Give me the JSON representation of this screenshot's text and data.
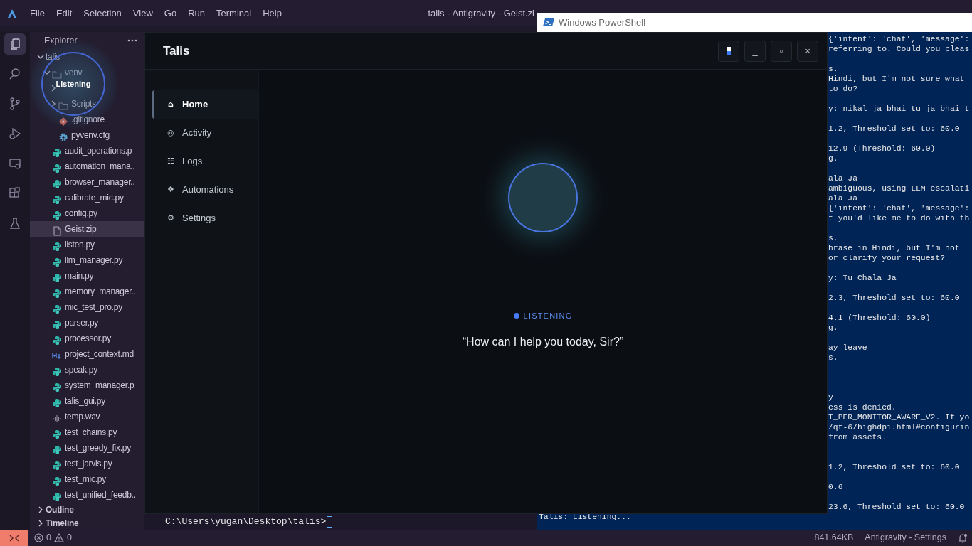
{
  "editor": {
    "menu": [
      "File",
      "Edit",
      "Selection",
      "View",
      "Go",
      "Run",
      "Terminal",
      "Help"
    ],
    "title": "talis - Antigravity - Geist.zi",
    "activity_bar": [
      {
        "kind": "files",
        "selected": true
      },
      {
        "kind": "search",
        "selected": false
      },
      {
        "kind": "branch",
        "selected": false
      },
      {
        "kind": "debug",
        "selected": false
      },
      {
        "kind": "remote",
        "selected": false
      },
      {
        "kind": "extensions",
        "selected": false
      },
      {
        "kind": "flask",
        "selected": false
      }
    ]
  },
  "explorer": {
    "title": "Explorer",
    "tree": [
      {
        "label": "talis",
        "expanded": true,
        "selected": false,
        "children": [
          {
            "label": "venv",
            "kind": "folder",
            "expanded": true,
            "selected": false,
            "children": [
              {
                "kind": "folder",
                "expanded": false
              },
              {
                "label": "Scripts",
                "kind": "folder",
                "expanded": false,
                "selected": false
              },
              {
                "label": ".gitignore",
                "kind": "git",
                "selected": false
              },
              {
                "label": "pyvenv.cfg",
                "kind": "config",
                "selected": false
              }
            ]
          },
          {
            "label": "audit_operations.p",
            "kind": "python",
            "selected": false
          },
          {
            "label": "automation_mana..",
            "kind": "python",
            "selected": false
          },
          {
            "label": "browser_manager..",
            "kind": "python",
            "selected": false
          },
          {
            "label": "calibrate_mic.py",
            "kind": "python",
            "selected": false
          },
          {
            "label": "config.py",
            "kind": "python",
            "selected": false
          },
          {
            "label": "Geist.zip",
            "kind": "file",
            "selected": true
          },
          {
            "label": "listen.py",
            "kind": "python",
            "selected": false
          },
          {
            "label": "llm_manager.py",
            "kind": "python",
            "selected": false
          },
          {
            "label": "main.py",
            "kind": "python",
            "selected": false
          },
          {
            "label": "memory_manager..",
            "kind": "python",
            "selected": false
          },
          {
            "label": "mic_test_pro.py",
            "kind": "python",
            "selected": false
          },
          {
            "label": "parser.py",
            "kind": "python",
            "selected": false
          },
          {
            "label": "processor.py",
            "kind": "python",
            "selected": false
          },
          {
            "label": "project_context.md",
            "kind": "markdown",
            "selected": false
          },
          {
            "label": "speak.py",
            "kind": "python",
            "selected": false
          },
          {
            "label": "system_manager.p",
            "kind": "python",
            "selected": false
          },
          {
            "label": "talis_gui.py",
            "kind": "python",
            "selected": false
          },
          {
            "label": "temp.wav",
            "kind": "audio",
            "selected": false
          },
          {
            "label": "test_chains.py",
            "kind": "python",
            "selected": false
          },
          {
            "label": "test_greedy_fix.py",
            "kind": "python",
            "selected": false
          },
          {
            "label": "test_jarvis.py",
            "kind": "python",
            "selected": false
          },
          {
            "label": "test_mic.py",
            "kind": "python",
            "selected": false
          },
          {
            "label": "test_unified_feedb..",
            "kind": "python",
            "selected": false
          }
        ]
      }
    ],
    "sections": [
      {
        "label": "Outline",
        "expanded": false
      },
      {
        "label": "Timeline",
        "expanded": false
      }
    ]
  },
  "overlay": {
    "label": "Listening"
  },
  "terminal": {
    "prompt": "C:\\Users\\yugan\\Desktop\\talis>"
  },
  "status_bar": {
    "errors": "0",
    "warnings": "0",
    "items": [
      "841.64KB",
      "Antigravity - Settings"
    ]
  },
  "talis": {
    "title": "Talis",
    "window_buttons": [
      {
        "kind": "pin"
      },
      {
        "kind": "minimize",
        "label": "_"
      },
      {
        "kind": "maximize",
        "label": "▫"
      },
      {
        "kind": "close",
        "label": "×"
      }
    ],
    "nav": [
      {
        "glyph": "⌂",
        "label": "Home",
        "selected": true
      },
      {
        "glyph": "◎",
        "label": "Activity",
        "selected": false
      },
      {
        "glyph": "☷",
        "label": "Logs",
        "selected": false
      },
      {
        "glyph": "❖",
        "label": "Automations",
        "selected": false
      },
      {
        "glyph": "⚙",
        "label": "Settings",
        "selected": false
      }
    ],
    "status": "LISTENING",
    "prompt": "“How can I help you today, Sir?”"
  },
  "powershell": {
    "title": "Windows PowerShell",
    "lines": [
      "{'intent': 'chat', 'message':",
      "referring to. Could you pleas",
      "s.",
      "Hindi, but I'm not sure what",
      "to do?",
      "y: nikal ja bhai tu ja bhai t",
      "1.2, Threshold set to: 60.0",
      "12.9 (Threshold: 60.0)",
      "g.",
      "ala Ja",
      "ambiguous, using LLM escalati",
      "ala Ja",
      "{'intent': 'chat', 'message':",
      "t you'd like me to do with th",
      "s.",
      "hrase in Hindi, but I'm not",
      "or clarify your request?",
      "y: Tu Chala Ja",
      "2.3, Threshold set to: 60.0",
      "4.1 (Threshold: 60.0)",
      "g.",
      "ay leave",
      "s.",
      "y",
      "ess is denied.",
      "T_PER_MONITOR_AWARE_V2. If yo",
      "/qt-6/highdpi.html#configurin",
      "from assets.",
      "1.2, Threshold set to: 60.0",
      "0.6",
      "23.6, Threshold set to: 60.0"
    ],
    "last_line": "Talis: Listening..."
  }
}
